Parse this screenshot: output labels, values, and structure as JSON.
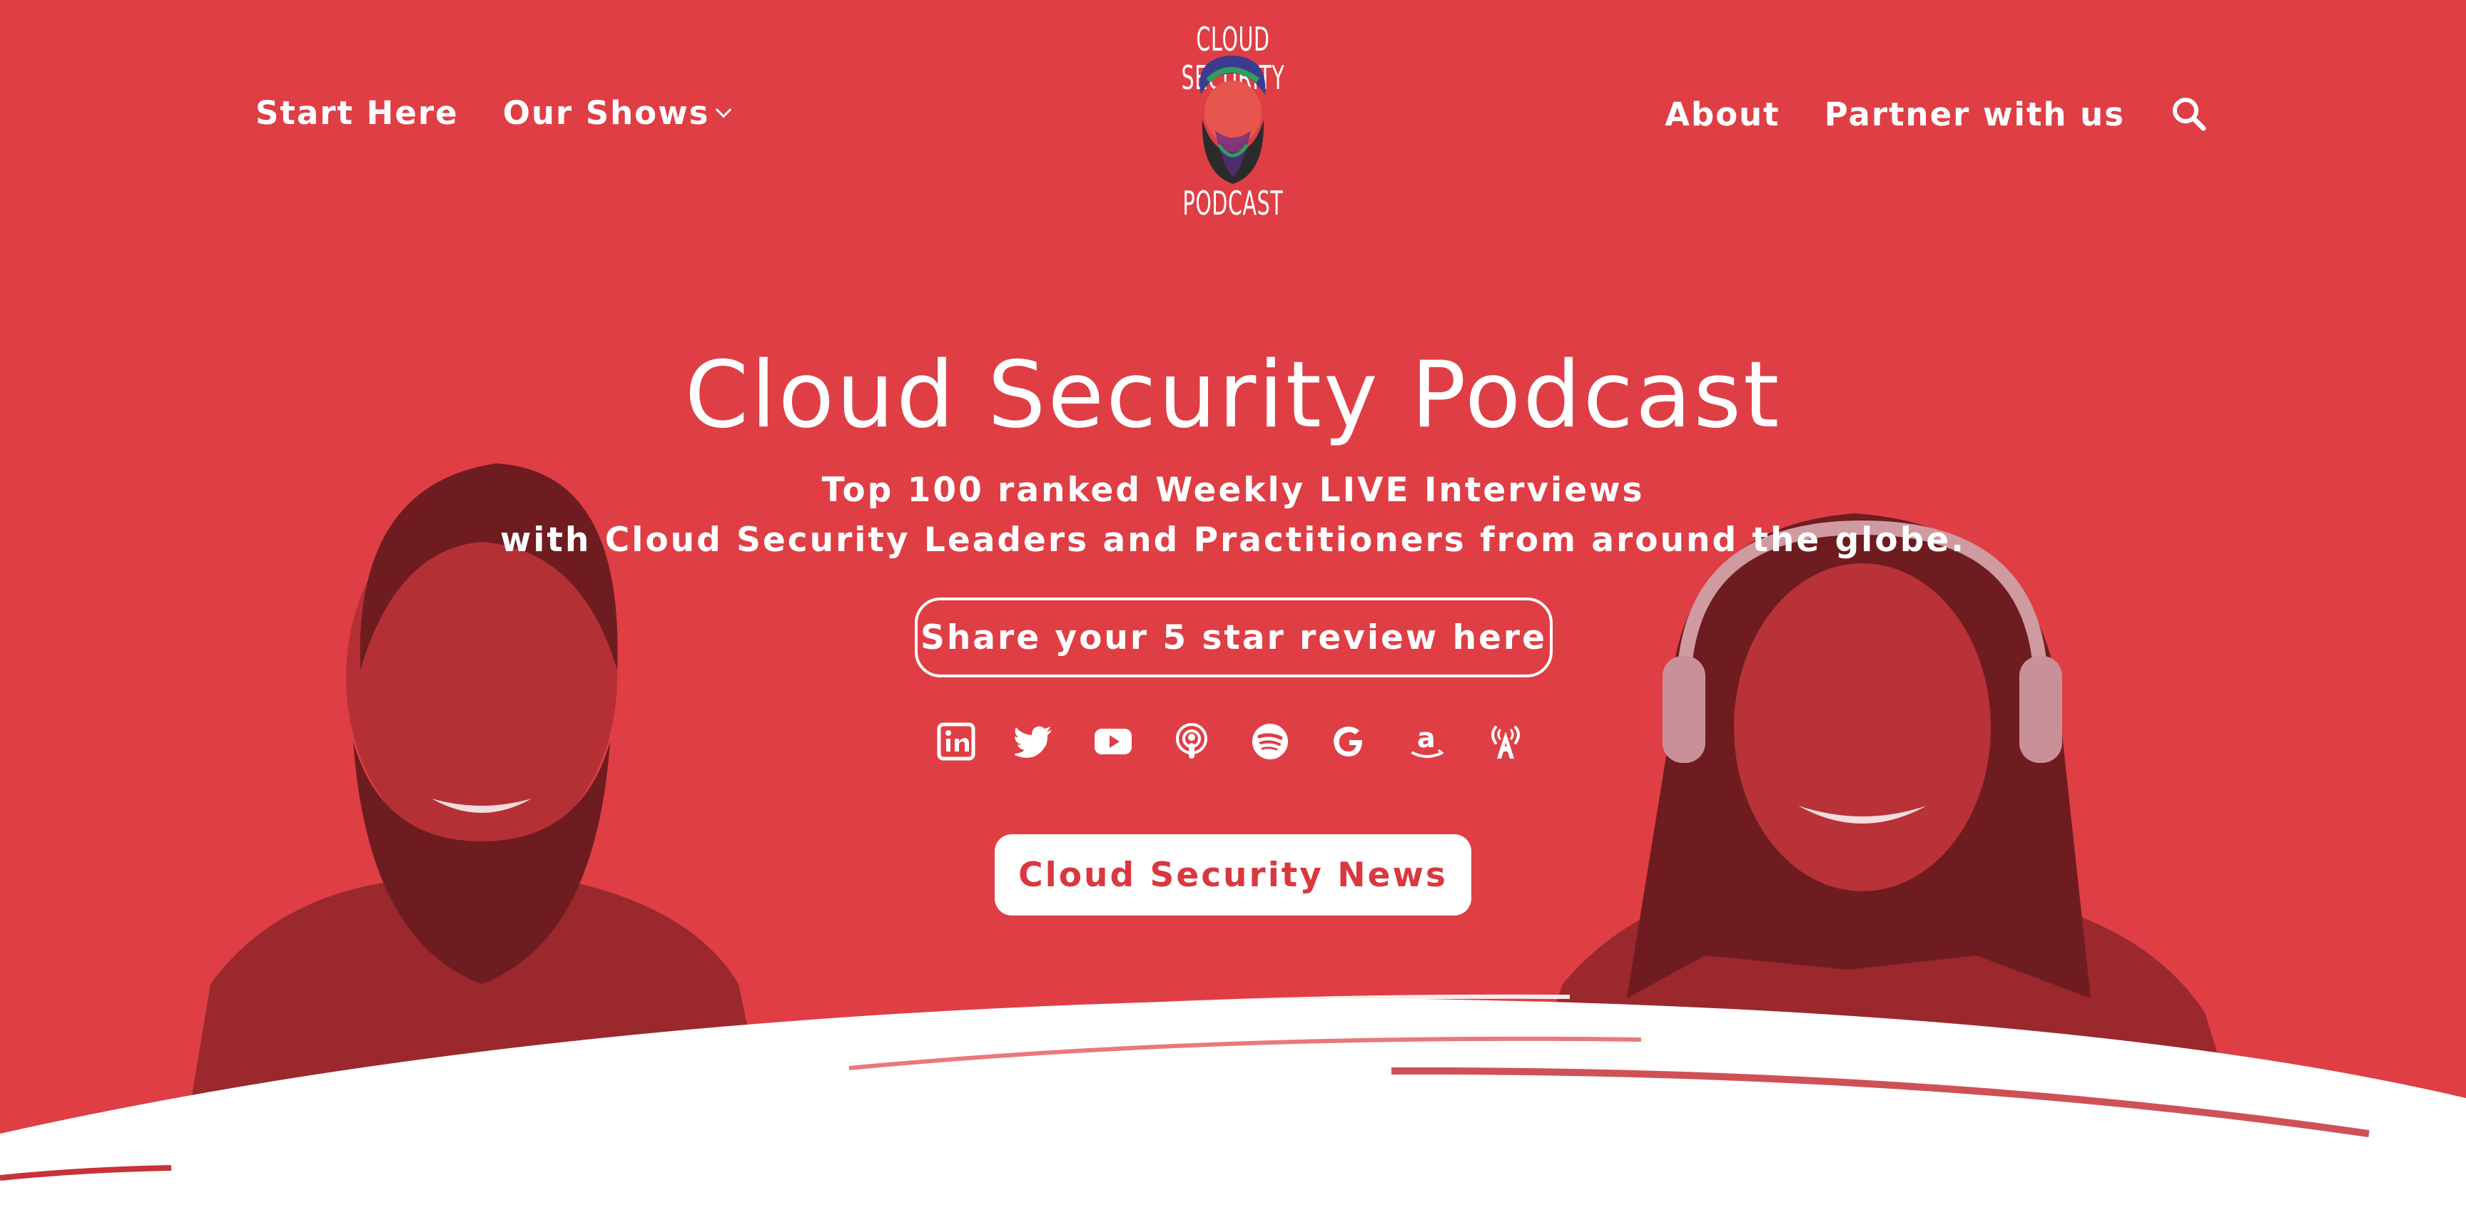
{
  "colors": {
    "hero_bg": "#df3e45",
    "text": "#ffffff",
    "accent_text": "#d9383f"
  },
  "nav": {
    "left": [
      {
        "label": "Start Here"
      },
      {
        "label": "Our Shows",
        "has_dropdown": true
      }
    ],
    "right": [
      {
        "label": "About"
      },
      {
        "label": "Partner with us"
      }
    ],
    "search_icon": "search-icon"
  },
  "logo": {
    "top_text": "CLOUD SECURITY",
    "bottom_text": "PODCAST"
  },
  "hero": {
    "title": "Cloud Security Podcast",
    "subtitle_line1": "Top 100 ranked Weekly LIVE Interviews",
    "subtitle_line2": "with Cloud Security Leaders and Practitioners from around the globe.",
    "review_button": "Share your 5 star review here",
    "news_button": "Cloud Security News"
  },
  "socials": [
    {
      "icon": "linkedin-icon"
    },
    {
      "icon": "twitter-icon"
    },
    {
      "icon": "youtube-icon"
    },
    {
      "icon": "apple-podcasts-icon"
    },
    {
      "icon": "spotify-icon"
    },
    {
      "icon": "google-icon"
    },
    {
      "icon": "amazon-icon"
    },
    {
      "icon": "podcast-addict-icon"
    }
  ]
}
